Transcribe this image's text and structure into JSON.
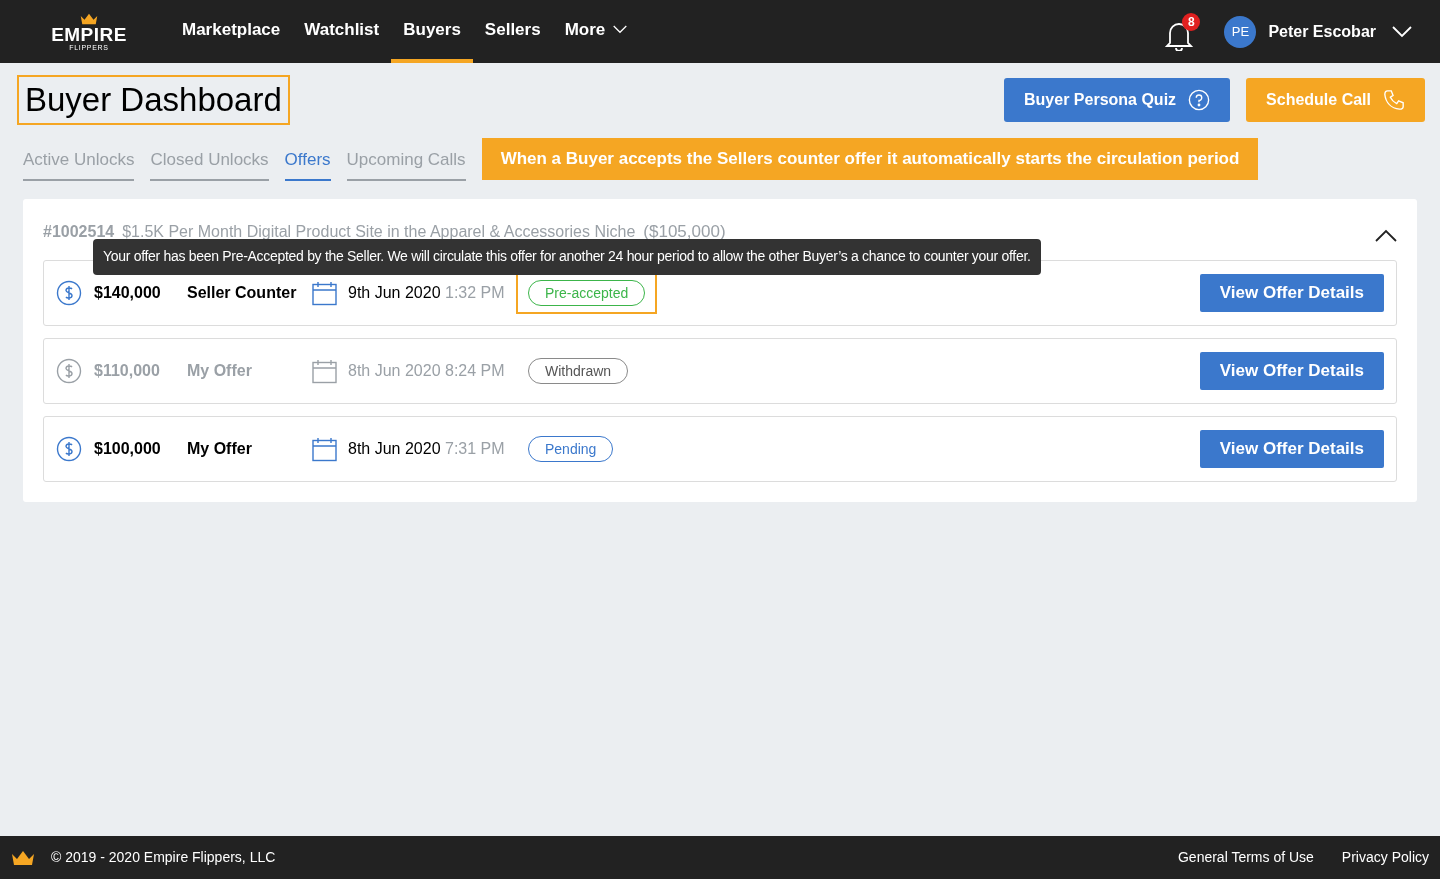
{
  "logo": {
    "name": "EMPIRE",
    "sub": "FLIPPERS"
  },
  "nav": [
    {
      "label": "Marketplace",
      "selected": false
    },
    {
      "label": "Watchlist",
      "selected": false
    },
    {
      "label": "Buyers",
      "selected": true
    },
    {
      "label": "Sellers",
      "selected": false
    },
    {
      "label": "More",
      "selected": false,
      "dropdown": true
    }
  ],
  "notifications": {
    "count": "8"
  },
  "user": {
    "initials": "PE",
    "name": "Peter Escobar"
  },
  "page_title": {
    "text": "Buyer Dashboard",
    "highlighted": true
  },
  "header_buttons": [
    {
      "label": "Buyer Persona Quiz",
      "kind": "quiz"
    },
    {
      "label": "Schedule Call",
      "kind": "call"
    }
  ],
  "tabs": [
    {
      "label": "Active Unlocks",
      "selected": false
    },
    {
      "label": "Closed Unlocks",
      "selected": false
    },
    {
      "label": "Offers",
      "selected": true
    },
    {
      "label": "Upcoming Calls",
      "selected": false
    }
  ],
  "banner": "When a Buyer accepts the Sellers counter offer it automatically starts the circulation period",
  "listing": {
    "id": "#1002514",
    "title": "$1.5K Per Month Digital Product Site in the Apparel & Accessories Niche",
    "price": "($105,000)",
    "expanded": true
  },
  "tooltip": "Your offer has been Pre-Accepted by the Seller. We will circulate this offer for another 24 hour period to allow the other Buyer’s a chance to counter your offer.",
  "offers": [
    {
      "amount": "$140,000",
      "type": "Seller Counter",
      "date": "9th Jun 2020",
      "time": "1:32 PM",
      "status": "Pre-accepted",
      "kind": "accepted",
      "highlighted": true,
      "dimmed": false,
      "button": "View Offer Details"
    },
    {
      "amount": "$110,000",
      "type": "My Offer",
      "date": "8th Jun 2020",
      "time": "8:24 PM",
      "status": "Withdrawn",
      "kind": "withdrawn",
      "highlighted": false,
      "dimmed": true,
      "button": "View Offer Details"
    },
    {
      "amount": "$100,000",
      "type": "My Offer",
      "date": "8th Jun 2020",
      "time": "7:31 PM",
      "status": "Pending",
      "kind": "pending",
      "highlighted": false,
      "dimmed": false,
      "button": "View Offer Details"
    }
  ],
  "footer": {
    "copyright": "© 2019 - 2020 Empire Flippers, LLC",
    "links": [
      "General Terms of Use",
      "Privacy Policy"
    ]
  }
}
